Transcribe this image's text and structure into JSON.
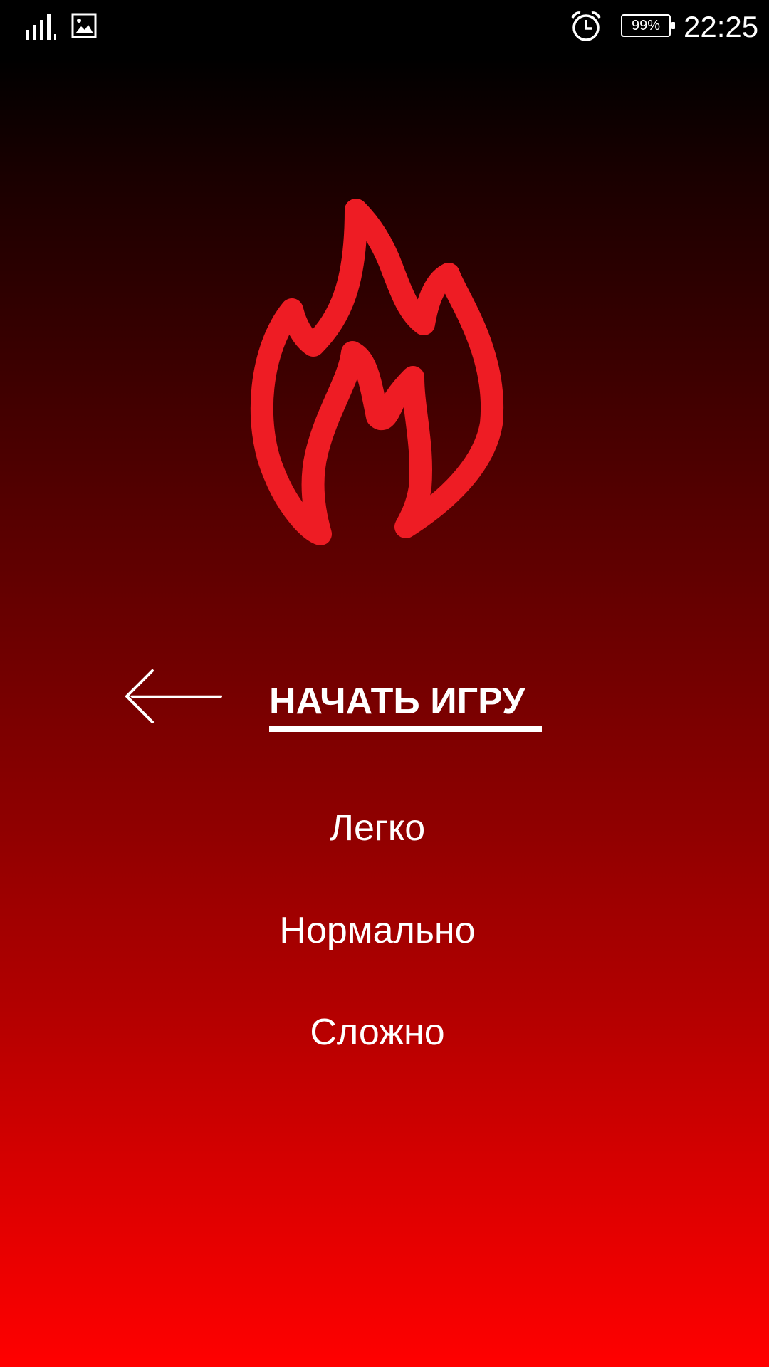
{
  "status_bar": {
    "battery_text": "99%",
    "time": "22:25",
    "icons": [
      "signal-icon",
      "gallery-icon",
      "alarm-icon",
      "battery-icon"
    ]
  },
  "menu": {
    "title": "НАЧАТЬ ИГРУ",
    "back_icon": "back-arrow-icon",
    "logo_icon": "flame-icon",
    "options": [
      {
        "label": "Легко"
      },
      {
        "label": "Нормально"
      },
      {
        "label": "Сложно"
      }
    ]
  },
  "colors": {
    "accent": "#ee1c24",
    "background_top": "#000000",
    "background_bottom": "#ff0000",
    "text": "#ffffff"
  }
}
